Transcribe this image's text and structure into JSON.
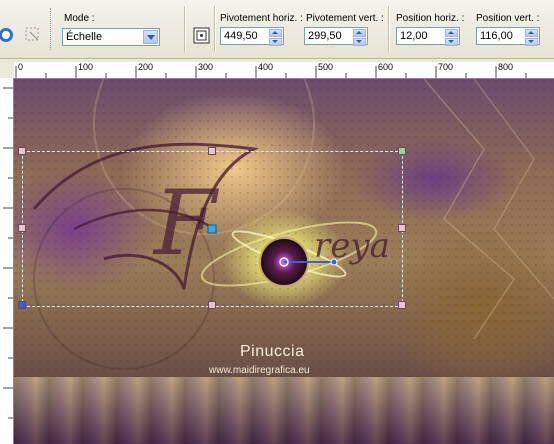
{
  "toolbar": {
    "mode_label": "Mode :",
    "mode_value": "Échelle",
    "pivot_h_label": "Pivotement horiz. :",
    "pivot_h_value": "449,50",
    "pivot_v_label": "Pivotement vert. :",
    "pivot_v_value": "299,50",
    "pos_h_label": "Position horiz. :",
    "pos_h_value": "12,00",
    "pos_v_label": "Position vert. :",
    "pos_v_value": "116,00"
  },
  "ruler": {
    "ticks": [
      "0",
      "100",
      "200",
      "300",
      "400",
      "500",
      "600",
      "700",
      "800"
    ]
  },
  "watermark": {
    "name": "Pinuccia",
    "url": "www.maidiregrafica.eu"
  },
  "canvas_text": {
    "script_letter": "F",
    "script_word": "reya"
  }
}
